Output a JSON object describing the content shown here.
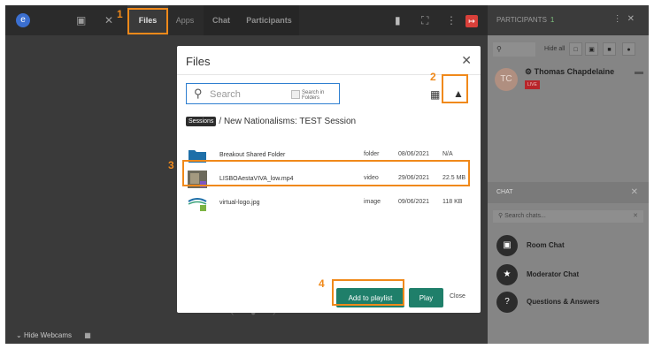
{
  "topbar": {
    "logo_text": "",
    "tabs": [
      {
        "label": "Files"
      },
      {
        "label": "Apps"
      },
      {
        "label": "Chat"
      },
      {
        "label": "Participants"
      }
    ]
  },
  "annotations": {
    "step1": "1",
    "step2": "2",
    "step3": "3",
    "step4": "4",
    "highlight_color": "#f0891a"
  },
  "participants_panel": {
    "title": "PARTICIPANTS",
    "count": "1",
    "search_icon": "search-icon",
    "hide_all_label": "Hide all",
    "participant": {
      "initials": "TC",
      "name": "Thomas Chapdelaine",
      "status": "LIVE"
    }
  },
  "chat_panel": {
    "title": "CHAT",
    "search_placeholder": "Search chats...",
    "items": [
      {
        "label": "Room Chat",
        "icon": "chat-bubble-icon"
      },
      {
        "label": "Moderator Chat",
        "icon": "star-icon"
      },
      {
        "label": "Questions & Answers",
        "icon": "question-icon"
      }
    ]
  },
  "bottom": {
    "hide_webcams_label": "Hide Webcams"
  },
  "files_modal": {
    "title": "Files",
    "search_placeholder": "Search",
    "search_in_folders_label": "Search in Folders",
    "breadcrumb_root": "Sessions",
    "breadcrumb_path": "/ New Nationalisms: TEST Session",
    "files": [
      {
        "name": "Breakout Shared Folder",
        "type": "folder",
        "date": "08/06/2021",
        "size": "N/A",
        "icon": "folder-icon"
      },
      {
        "name": "LISBOAestaVIVA_low.mp4",
        "type": "video",
        "date": "29/06/2021",
        "size": "22.5 MB",
        "icon": "video-thumbnail-icon"
      },
      {
        "name": "virtual-logo.jpg",
        "type": "image",
        "date": "09/06/2021",
        "size": "118 KB",
        "icon": "image-thumbnail-icon"
      }
    ],
    "buttons": {
      "add_to_playlist": "Add to playlist",
      "play": "Play",
      "close": "Close"
    },
    "accent_color": "#1f7f6a"
  }
}
